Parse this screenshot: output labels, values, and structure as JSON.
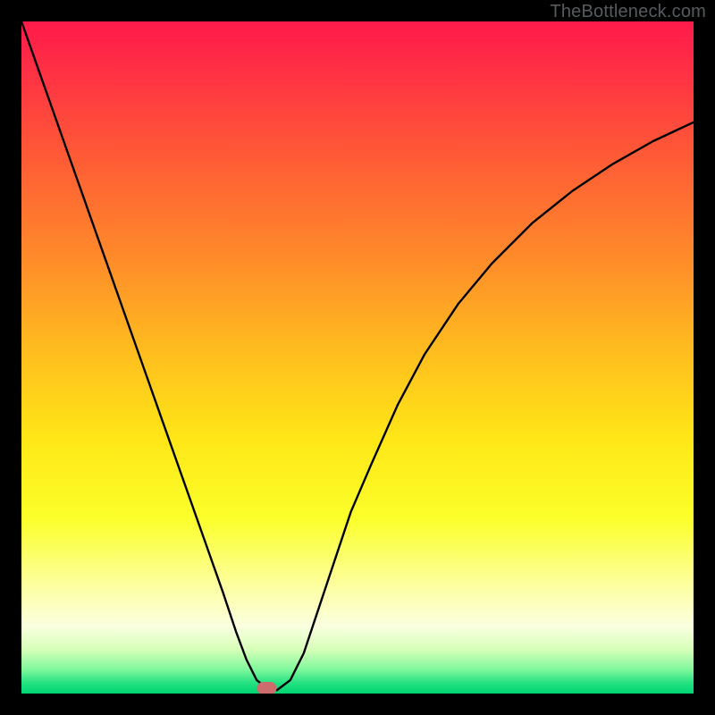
{
  "watermark": "TheBottleneck.com",
  "chart_data": {
    "type": "line",
    "title": "",
    "xlabel": "",
    "ylabel": "",
    "xlim": [
      0,
      100
    ],
    "ylim": [
      0,
      100
    ],
    "gradient_stops": [
      {
        "offset": 0.0,
        "color": "#ff1a4b"
      },
      {
        "offset": 0.07,
        "color": "#ff2f45"
      },
      {
        "offset": 0.2,
        "color": "#ff5a36"
      },
      {
        "offset": 0.35,
        "color": "#ff8a2a"
      },
      {
        "offset": 0.5,
        "color": "#ffc01e"
      },
      {
        "offset": 0.62,
        "color": "#ffe617"
      },
      {
        "offset": 0.74,
        "color": "#fbff2a"
      },
      {
        "offset": 0.84,
        "color": "#fdffa0"
      },
      {
        "offset": 0.9,
        "color": "#faffe0"
      },
      {
        "offset": 0.935,
        "color": "#d6ffb8"
      },
      {
        "offset": 0.965,
        "color": "#7cf79b"
      },
      {
        "offset": 0.985,
        "color": "#22e080"
      },
      {
        "offset": 1.0,
        "color": "#00d472"
      }
    ],
    "series": [
      {
        "name": "bottleneck-curve",
        "x": [
          0,
          3,
          6,
          9,
          12,
          15,
          18,
          21,
          24,
          27,
          30,
          32,
          33.5,
          35,
          36.5,
          38,
          40,
          42,
          44,
          46,
          49,
          52,
          56,
          60,
          65,
          70,
          76,
          82,
          88,
          94,
          100
        ],
        "y": [
          100,
          91.5,
          83,
          74.5,
          66,
          57.5,
          49,
          40.5,
          32,
          23.5,
          15,
          9,
          5,
          2,
          0.8,
          0.5,
          2,
          6,
          12,
          18,
          27,
          34,
          43,
          50.5,
          58,
          64,
          70,
          74.8,
          78.8,
          82.2,
          85
        ]
      }
    ],
    "marker": {
      "x": 36.5,
      "y": 0.8,
      "color": "#cc6c6c"
    }
  }
}
